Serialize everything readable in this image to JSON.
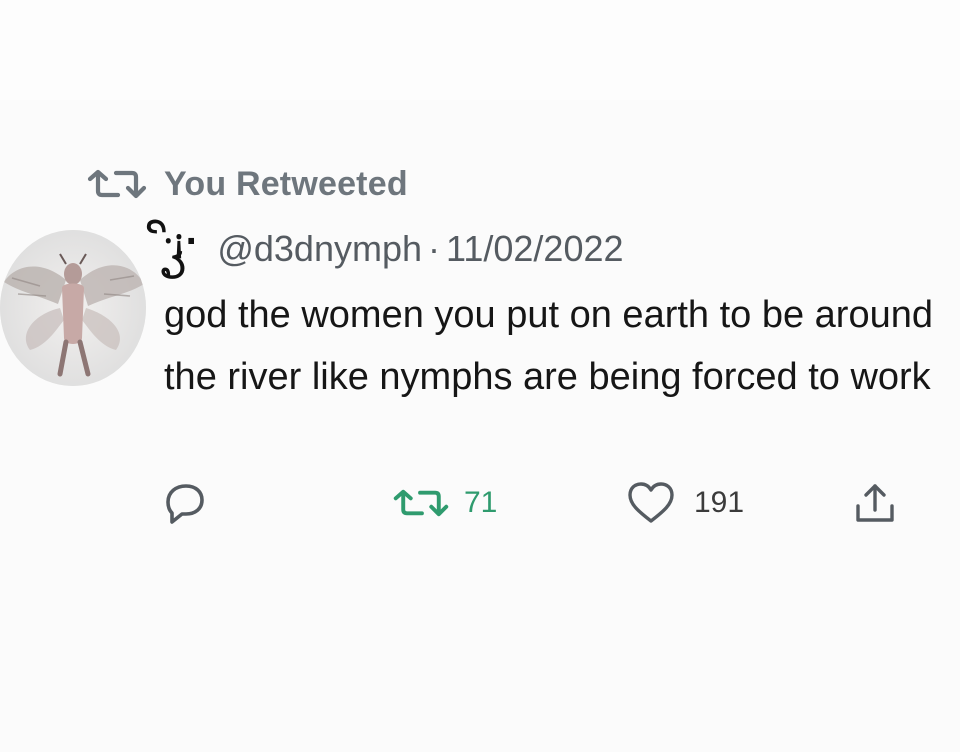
{
  "retweet_banner": {
    "label": "You Retweeted",
    "icon": "retweet-icon"
  },
  "tweet": {
    "display_name": "·ꦼ¡ꦽ·",
    "handle": "@d3dnymph",
    "separator": "·",
    "date": "11/02/2022",
    "text": "god the women you put on earth to be around the river like nymphs are being forced to work",
    "avatar": "avatar-moth-figure"
  },
  "actions": {
    "reply": {
      "icon": "reply-icon"
    },
    "retweet": {
      "icon": "retweet-icon",
      "count": "71"
    },
    "like": {
      "icon": "heart-icon",
      "count": "191"
    },
    "share": {
      "icon": "share-icon"
    }
  },
  "colors": {
    "muted": "#6e767d",
    "retweet_active": "#2f9b6e",
    "text": "#151515",
    "background": "#fbfbfb"
  }
}
